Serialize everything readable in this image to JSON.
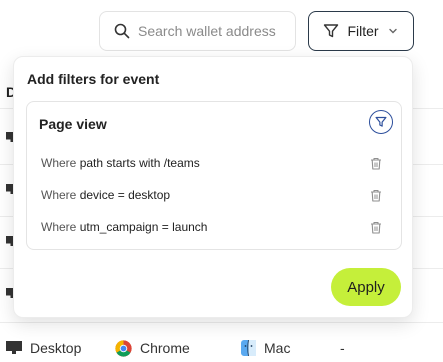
{
  "search": {
    "placeholder": "Search wallet address"
  },
  "filter_button": {
    "label": "Filter"
  },
  "table": {
    "header_partial": "D",
    "bottom_row": {
      "device": "Desktop",
      "browser": "Chrome",
      "os": "Mac",
      "extra": "-"
    }
  },
  "popover": {
    "title": "Add filters for event",
    "event": {
      "name": "Page view",
      "conditions": [
        {
          "prefix": "Where",
          "field": "path",
          "op": "starts with",
          "value": "/teams"
        },
        {
          "prefix": "Where",
          "field": "device",
          "op": "=",
          "value": "desktop"
        },
        {
          "prefix": "Where",
          "field": "utm_campaign",
          "op": "=",
          "value": "launch"
        }
      ]
    },
    "apply_label": "Apply"
  },
  "colors": {
    "accent": "#c5ef3a",
    "filter_ring": "#2d4f9c"
  }
}
